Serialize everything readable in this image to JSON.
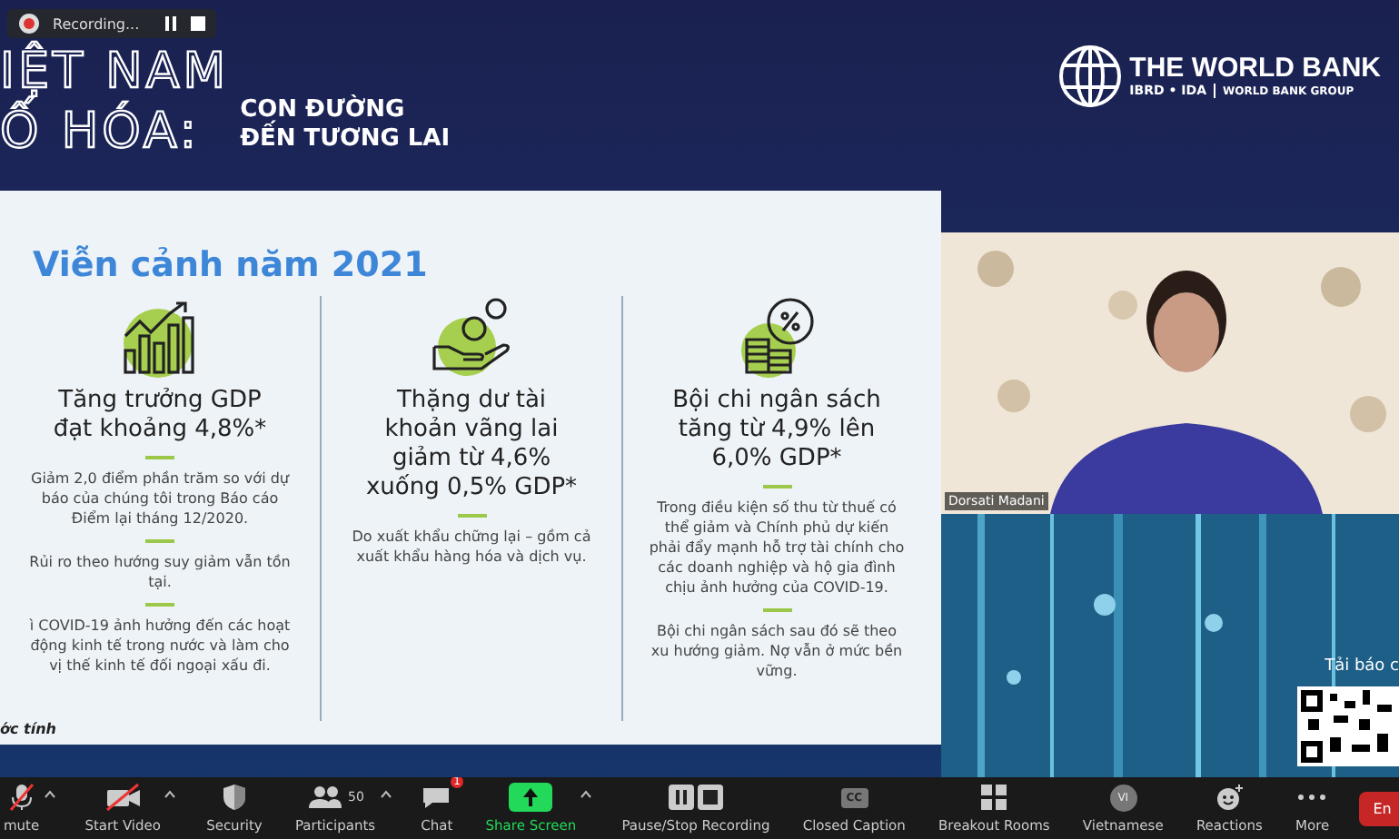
{
  "recording": {
    "label": "Recording..."
  },
  "banner": {
    "title_lines": [
      "IỆT NAM",
      "Ố HÓA:"
    ],
    "subtitle_lines": [
      "CON ĐƯỜNG",
      "ĐẾN TƯƠNG LAI"
    ],
    "logo_name": "THE WORLD BANK",
    "logo_sub_left": "IBRD • IDA",
    "logo_sub_right": "WORLD BANK GROUP"
  },
  "slide": {
    "heading": "Viễn cảnh năm 2021",
    "columns": [
      {
        "kind": "chart",
        "title": "Tăng trưởng GDP đạt khoảng 4,8%*",
        "paragraphs": [
          "Giảm 2,0 điểm phần trăm so với dự báo của chúng tôi trong Báo cáo Điểm lại tháng 12/2020.",
          "Rủi ro theo hướng suy giảm vẫn tồn tại.",
          "ì COVID-19 ảnh hưởng đến các hoạt động kinh tế trong nước và làm cho vị thế kinh tế đối ngoại xấu đi."
        ]
      },
      {
        "kind": "hand",
        "title": "Thặng dư tài khoản vãng lai giảm từ 4,6% xuống 0,5% GDP*",
        "paragraphs": [
          "Do xuất khẩu chững lại – gồm cả xuất khẩu hàng hóa và dịch vụ."
        ]
      },
      {
        "kind": "coins",
        "title": "Bội chi ngân sách tăng từ 4,9% lên 6,0% GDP*",
        "paragraphs": [
          "Trong điều kiện số thu từ thuế có thể giảm và Chính phủ dự kiến phải đẩy mạnh hỗ trợ tài chính cho các doanh nghiệp và hộ gia đình chịu ảnh hưởng của COVID-19.",
          "Bội chi ngân sách sau đó sẽ theo xu hướng giảm. Nợ vẫn ở mức bền vững."
        ]
      }
    ],
    "footnote": "ớc tính"
  },
  "videos": [
    {
      "name": "Dorsati Madani"
    },
    {
      "caption": "Tải báo c"
    }
  ],
  "toolbar": [
    {
      "kind": "mic",
      "label": "mute",
      "off": true,
      "caret": true
    },
    {
      "kind": "video",
      "label": "Start Video",
      "off": true,
      "caret": true
    },
    {
      "kind": "security",
      "label": "Security"
    },
    {
      "kind": "participants",
      "label": "Participants",
      "count": "50",
      "caret": true
    },
    {
      "kind": "chat",
      "label": "Chat",
      "badge": "1"
    },
    {
      "kind": "share",
      "label": "Share Screen",
      "caret": true
    },
    {
      "kind": "recording",
      "label": "Pause/Stop Recording"
    },
    {
      "kind": "cc",
      "label": "Closed Caption",
      "glyph": "CC"
    },
    {
      "kind": "breakout",
      "label": "Breakout Rooms"
    },
    {
      "kind": "language",
      "label": "Vietnamese",
      "glyph": "VI"
    },
    {
      "kind": "reactions",
      "label": "Reactions"
    },
    {
      "kind": "more",
      "label": "More"
    }
  ],
  "end_button": "En"
}
